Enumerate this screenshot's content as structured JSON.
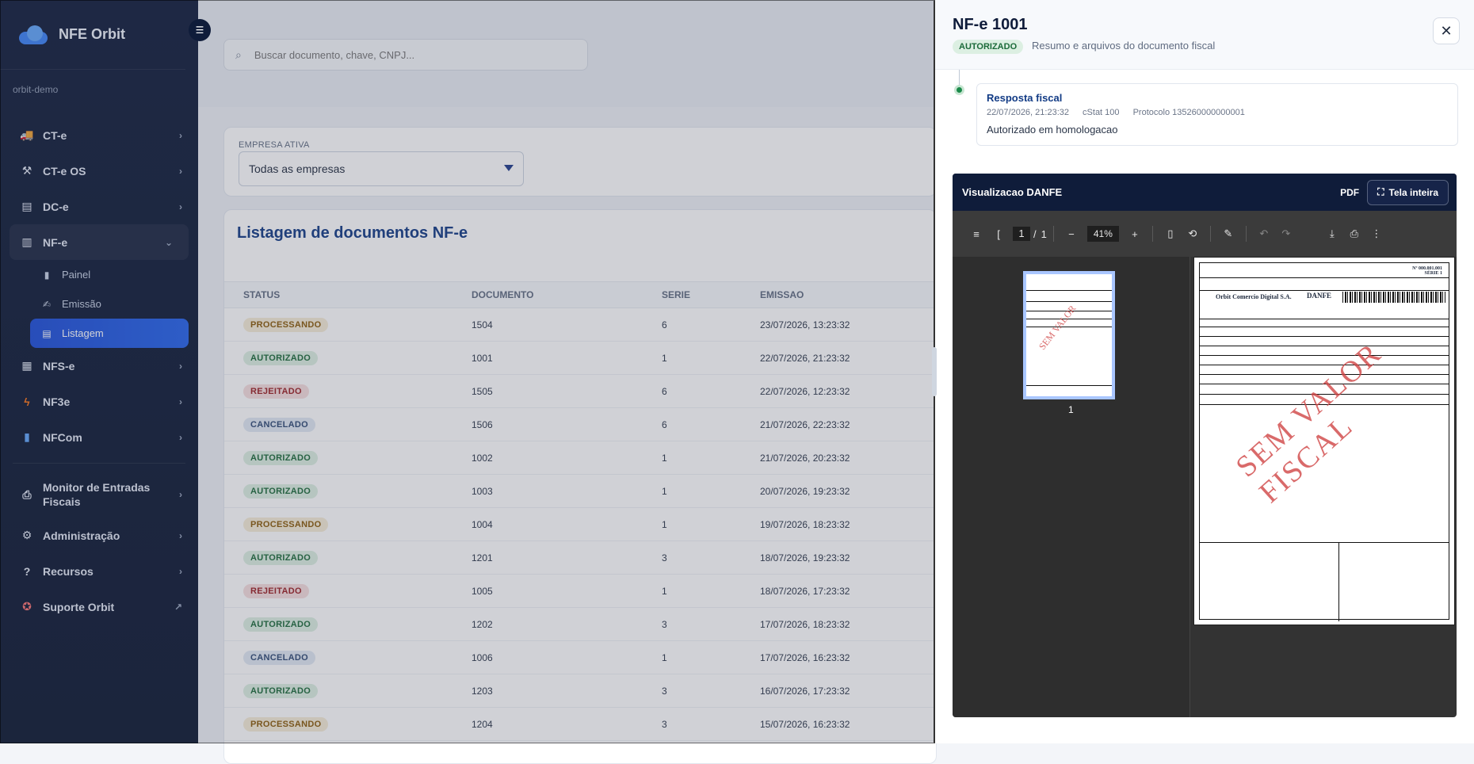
{
  "app": {
    "name": "NFE Orbit",
    "org": "orbit-demo"
  },
  "sidebar": {
    "items": [
      {
        "label": "CT-e"
      },
      {
        "label": "CT-e OS"
      },
      {
        "label": "DC-e"
      },
      {
        "label": "NF-e"
      },
      {
        "label": "NFS-e"
      },
      {
        "label": "NF3e"
      },
      {
        "label": "NFCom"
      },
      {
        "label": "Monitor de Entradas Fiscais"
      },
      {
        "label": "Administração"
      },
      {
        "label": "Recursos"
      },
      {
        "label": "Suporte Orbit"
      }
    ],
    "nfe_sub": [
      {
        "label": "Painel"
      },
      {
        "label": "Emissão"
      },
      {
        "label": "Listagem"
      }
    ]
  },
  "search": {
    "placeholder": "Buscar documento, chave, CNPJ..."
  },
  "empresa": {
    "label": "EMPRESA ATIVA",
    "value": "Todas as empresas"
  },
  "listing": {
    "title": "Listagem de documentos NF-e",
    "headers": [
      "STATUS",
      "DOCUMENTO",
      "SERIE",
      "EMISSAO"
    ],
    "rows": [
      {
        "status": "PROCESSANDO",
        "doc": "1504",
        "serie": "6",
        "emissao": "23/07/2026, 13:23:32"
      },
      {
        "status": "AUTORIZADO",
        "doc": "1001",
        "serie": "1",
        "emissao": "22/07/2026, 21:23:32"
      },
      {
        "status": "REJEITADO",
        "doc": "1505",
        "serie": "6",
        "emissao": "22/07/2026, 12:23:32"
      },
      {
        "status": "CANCELADO",
        "doc": "1506",
        "serie": "6",
        "emissao": "21/07/2026, 22:23:32"
      },
      {
        "status": "AUTORIZADO",
        "doc": "1002",
        "serie": "1",
        "emissao": "21/07/2026, 20:23:32"
      },
      {
        "status": "AUTORIZADO",
        "doc": "1003",
        "serie": "1",
        "emissao": "20/07/2026, 19:23:32"
      },
      {
        "status": "PROCESSANDO",
        "doc": "1004",
        "serie": "1",
        "emissao": "19/07/2026, 18:23:32"
      },
      {
        "status": "AUTORIZADO",
        "doc": "1201",
        "serie": "3",
        "emissao": "18/07/2026, 19:23:32"
      },
      {
        "status": "REJEITADO",
        "doc": "1005",
        "serie": "1",
        "emissao": "18/07/2026, 17:23:32"
      },
      {
        "status": "AUTORIZADO",
        "doc": "1202",
        "serie": "3",
        "emissao": "17/07/2026, 18:23:32"
      },
      {
        "status": "CANCELADO",
        "doc": "1006",
        "serie": "1",
        "emissao": "17/07/2026, 16:23:32"
      },
      {
        "status": "AUTORIZADO",
        "doc": "1203",
        "serie": "3",
        "emissao": "16/07/2026, 17:23:32"
      },
      {
        "status": "PROCESSANDO",
        "doc": "1204",
        "serie": "3",
        "emissao": "15/07/2026, 16:23:32"
      }
    ]
  },
  "drawer": {
    "title": "NF-e 1001",
    "status": "AUTORIZADO",
    "subtitle": "Resumo e arquivos do documento fiscal",
    "response": {
      "title": "Resposta fiscal",
      "date": "22/07/2026, 21:23:32",
      "cstat": "cStat 100",
      "protocolo": "Protocolo 135260000000001",
      "desc": "Autorizado em homologacao"
    },
    "viewer": {
      "title": "Visualizacao DANFE",
      "pdf": "PDF",
      "fullscreen": "Tela inteira",
      "page": "1",
      "total": "1",
      "zoom": "41%",
      "thumb_page": "1",
      "watermark": "SEM VALOR FISCAL",
      "issuer": "Orbit Comercio Digital S.A.",
      "doc_title": "DANFE",
      "nf_number": "Nº 000.001.001",
      "serie": "SÉRIE 1"
    }
  }
}
